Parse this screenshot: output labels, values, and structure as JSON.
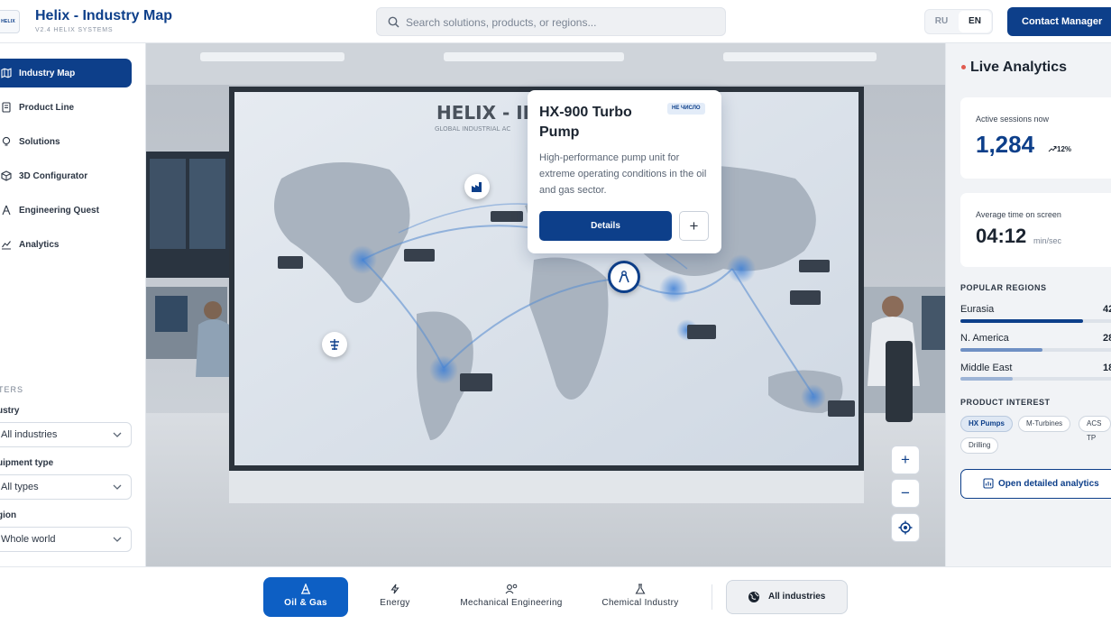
{
  "header": {
    "logo_text": "HELIX",
    "title": "Helix - Industry Map",
    "subtitle": "V2.4 HELIX SYSTEMS",
    "search_placeholder": "Search solutions, products, or regions...",
    "lang": [
      "RU",
      "EN"
    ],
    "lang_active": "EN",
    "contact_label": "Contact Manager"
  },
  "sidebar": {
    "items": [
      {
        "label": "Industry Map",
        "icon": "map-icon",
        "active": true
      },
      {
        "label": "Product Line",
        "icon": "document-icon"
      },
      {
        "label": "Solutions",
        "icon": "lightbulb-icon"
      },
      {
        "label": "3D Configurator",
        "icon": "cube-icon"
      },
      {
        "label": "Engineering Quest",
        "icon": "compass-icon"
      },
      {
        "label": "Analytics",
        "icon": "chart-icon"
      }
    ],
    "filters_title": "TERS",
    "filters": [
      {
        "label": "ustry",
        "value": "All industries"
      },
      {
        "label": "uipment type",
        "value": "All types"
      },
      {
        "label": "gion",
        "value": "Whole world"
      }
    ]
  },
  "map": {
    "wall_title": "HELIX - IN",
    "wall_subtitle": "GLOBAL INDUSTRIAL AC",
    "popup": {
      "title": "HX-900 Turbo Pump",
      "badge": "НЕ ЧИСЛО",
      "description": "High-performance pump unit for extreme operating conditions in the oil and gas sector.",
      "details_label": "Details",
      "add_label": "+"
    },
    "zoom_in": "+",
    "zoom_out": "−"
  },
  "analytics": {
    "title": "Live Analytics",
    "sessions_label": "Active sessions now",
    "sessions_value": "1,284",
    "sessions_trend": "12%",
    "time_label": "Average time on screen",
    "time_value": "04:12",
    "time_unit": "min/sec",
    "regions_title": "POPULAR REGIONS",
    "regions": [
      {
        "name": "Eurasia",
        "value": "42",
        "fill": 0.42,
        "color": "#0d3f8a"
      },
      {
        "name": "N. America",
        "value": "28",
        "fill": 0.28,
        "color": "#6f90c4"
      },
      {
        "name": "Middle East",
        "value": "18",
        "fill": 0.18,
        "color": "#9db4d6"
      }
    ],
    "interest_title": "PRODUCT INTEREST",
    "interest": [
      "HX Pumps",
      "M-Turbines",
      "ACS TP",
      "Drilling"
    ],
    "interest_active": "HX Pumps",
    "open_label": "Open detailed analytics"
  },
  "industries": [
    {
      "label": "Oil & Gas",
      "icon": "oil-rig-icon",
      "active": true
    },
    {
      "label": "Energy",
      "icon": "lightning-icon"
    },
    {
      "label": "Mechanical Engineering",
      "icon": "engineer-icon"
    },
    {
      "label": "Chemical Industry",
      "icon": "flask-icon"
    }
  ],
  "all_industries_label": "All industries",
  "colors": {
    "primary": "#0d3f8a",
    "accent": "#0d5fc4",
    "live_dot": "#e05a4f"
  }
}
